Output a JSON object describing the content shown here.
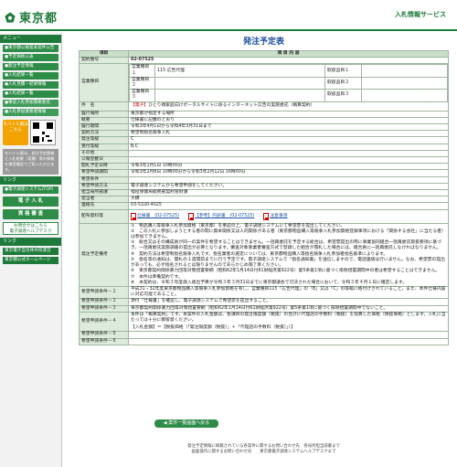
{
  "header": {
    "logo_text": "東京都",
    "right_title": "入札情報サービス"
  },
  "sidebar": {
    "section_menu": "メニュー",
    "items": [
      "●東京都公報発表案件公告",
      "●予定価格公表",
      "●発注予定情報",
      "●入札結果一覧",
      "●入札見積・結果情報",
      "●入札結果一覧",
      "●事前入札参加資格者名",
      "●入札参加資格者情報"
    ],
    "mobile_label": "モバイル版はこちら",
    "mobile_note": "モバイル版は、発注予定情報と入札結果（見積）等の情報を携帯電話でご覧いただけます。",
    "section_links": "リンク",
    "big_items": [
      "●電子調達システム(TOP)",
      "電 子 入 札",
      "資 格 審 査"
    ],
    "ask_label": "お問合せはこちら",
    "ask_sub": "電子調達ヘルプデスク",
    "section_other": "リンク",
    "links": [
      "東京電子自治体共同運営",
      "東京都公式ホームページ"
    ]
  },
  "main": {
    "title": "発注予定表",
    "col_item": "項目",
    "col_content": "項 目 内 容",
    "back_button": "案件一覧画面へ戻る"
  },
  "rows": {
    "contract_no_label": "契約番号",
    "contract_no": "02-07525",
    "business_label": "営業種目",
    "business": [
      {
        "name": "営業種目１",
        "value": "115 広告代理",
        "rank_label": "取扱品目１",
        "rank": ""
      },
      {
        "name": "営業種目２",
        "value": "",
        "rank_label": "取扱品目２",
        "rank": ""
      },
      {
        "name": "営業種目３",
        "value": "",
        "rank_label": "取扱品目３",
        "rank": ""
      }
    ],
    "subject_label": "件　名",
    "subject_tag": "【電子】",
    "subject": "ひとり親家庭向けポータルサイトに係るインターネット広告の実施委託（概算契約）",
    "location_label": "履行場所",
    "location": "東京都が指定する場所",
    "summary_label": "概要",
    "summary": "仕様書に記載のとおり",
    "period_label": "履行期間",
    "period": "令和3年4月1日から令和4年3月31日まで",
    "method_label": "契約方法",
    "method": "希望制指名競争入札",
    "rank_label": "発注等級",
    "rank": "C",
    "accept_label": "受付等級",
    "accept": "B,C",
    "other_label": "その他",
    "other": "",
    "notice_label": "公報登載日",
    "notice": "",
    "open_label": "開札予定日時",
    "open": "令和3年1月1日 10時00分",
    "apply_label": "希望申請期間",
    "apply": "令和3年2月8日 10時00分から令和3年2月12日 16時00分",
    "qualify_label": "希望条件",
    "qualify": "",
    "apply_method_label": "希望申請方法",
    "apply_method": "電子調達システムから希望申請をしてください。",
    "dept_label": "担当局所部課",
    "dept": "福祉保健局総務部契約管財課",
    "person_label": "担当者",
    "person": "大橋",
    "tel_label": "連絡先",
    "tel": "03-5320-4025",
    "docs_label": "配布資料等",
    "docs": [
      "仕様書　(02-07525)",
      "【参考】内訳書　(02-07525)",
      "注意事項"
    ],
    "points_label": "発注予定備考",
    "points": [
      "①　物品購入等競争入札参加資格（東京都）を承認の上、電子調達システムにて希望票を提出してください。",
      "②　この入札に参加しようとする者の間に資本関係又は人的関係がある者（東京都物品購入等競争入札参加資格登録事項における「関係する会社」に当たる者）は参加できません。",
      "③　総合又はその構成員が同一の案件を希望することはできません。一括再委託を予定する総合は、希望票提出の際に事業協同組合一括再委託取扱要項に基づき、一括再委託実施調書の提出が必要となります。審査対象事業者審査方式で登録した組合が落札した場合には、組合員に一括再委託しなければなりません。",
      "④　契約方法は希望制指名競争入札です。指名業者の選定については、東京都物品購入等指名競争入札参加者指名基準によります。",
      "⑤　指名等の通知は、開札の１週間前までに行う予定です。電子調達システムで「指名通知書」を送信しますので、電話連絡は行いません。なお、希望票の提出があっても、必ず指名されるとは限りませんのであらかじめ御了承ください。",
      "⑥　東京都契約関係暴力団等対策措置要綱（昭和62年1月14日付61財経庶第922号）第5条第1項に基づく排除措置期間中の者は希望することはできません。",
      "⑦　本件は準備契約です。",
      "⑧　本契約は、令和３年度歳入歳出予算が令和３年３月31日までに東京都議会で可決された場合において、令和３年４月１日に確定します。"
    ],
    "cond1_label": "希望申請条件－１",
    "cond1": "平成31・32年度東京都物品購入等競争入札参加資格を有し、営業種目115「広告代理」の「B」又は「C」の等級に格付けされていること。また、本件仕様内容に対応可能であること。",
    "cond2_label": "希望申請条件－２",
    "cond2": "添付「仕様書」を確認し、電子調達システムで希望票を提出すること。",
    "cond3_label": "希望申請条件－３",
    "cond3": "東京都契約関係暴力団等対策措置要綱（昭和62年1月14日付61財経庶第922号）第5条第1項に基づく排除措置期間中でないこと。",
    "cond4_label": "希望申請条件－４",
    "cond4": "本件は「概算契約」です。本案件の入札金額は、各課目の発注限度額（税抜）の合計に代理店の手数料（税抜）を加算した価格（税抜価格）とします。入札に当たっては十分に御留意ください。",
    "cond4_formula": "【入札金額】＝【税抜価格（「発注限度額（税抜）」＋「代理店の手数料（税抜）」）】",
    "cond5_label": "希望申請条件－５",
    "cond5": "",
    "cond6_label": "希望申請条件－６",
    "cond6": ""
  },
  "footer": {
    "line1": "発注予定情報に掲載されている各案件に関するお問い合わせ先　各局所担当部署まで",
    "line2": "画面操作に関するお問い合わせ先　　東京都電子調達システムヘルプデスクまで"
  }
}
